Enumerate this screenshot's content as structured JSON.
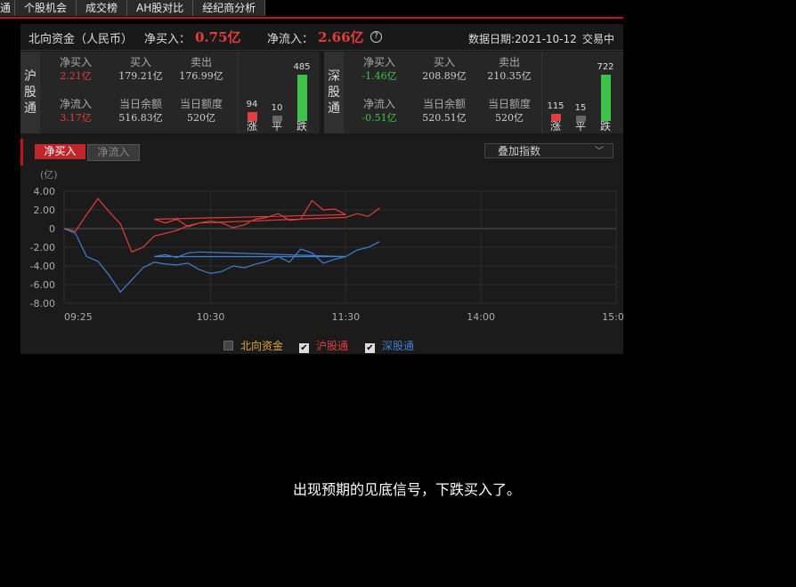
{
  "tabs": [
    "通",
    "个股机会",
    "成交榜",
    "AH股对比",
    "经纪商分析"
  ],
  "header": {
    "title": "北向资金（人民币）",
    "net_buy_label": "净买入：",
    "net_buy_value": "0.75亿",
    "net_inflow_label": "净流入：",
    "net_inflow_value": "2.66亿",
    "help_icon": "?",
    "date": "数据日期:2021-10-12",
    "status": "交易中"
  },
  "sh": {
    "label": "沪股通",
    "net_buy_label": "净买入",
    "net_buy": "2.21亿",
    "buy_label": "买入",
    "buy": "179.21亿",
    "sell_label": "卖出",
    "sell": "176.99亿",
    "net_inflow_label": "净流入",
    "net_inflow": "3.17亿",
    "balance_label": "当日余额",
    "balance": "516.83亿",
    "quota_label": "当日额度",
    "quota": "520亿",
    "up": 94,
    "flat": 10,
    "down": 485,
    "up_label": "涨",
    "flat_label": "平",
    "down_label": "跌"
  },
  "sz": {
    "label": "深股通",
    "net_buy_label": "净买入",
    "net_buy": "-1.46亿",
    "buy_label": "买入",
    "buy": "208.89亿",
    "sell_label": "卖出",
    "sell": "210.35亿",
    "net_inflow_label": "净流入",
    "net_inflow": "-0.51亿",
    "balance_label": "当日余额",
    "balance": "520.51亿",
    "quota_label": "当日额度",
    "quota": "520亿",
    "up": 115,
    "flat": 15,
    "down": 722,
    "up_label": "涨",
    "flat_label": "平",
    "down_label": "跌"
  },
  "chart_controls": {
    "btn_net_buy": "净买入",
    "btn_net_inflow": "净流入",
    "overlay_label": "叠加指数",
    "overlay_chevron": "﹀"
  },
  "legend": {
    "north": "北向资金",
    "sh": "沪股通",
    "sz": "深股通",
    "check_mark": "✔"
  },
  "colors": {
    "red": "#e63c3c",
    "green": "#3ec24a",
    "blue": "#3f7fd1",
    "gold": "#d9a640"
  },
  "caption": "出现预期的见底信号，下跌买入了。",
  "chart_data": {
    "type": "line",
    "ylabel": "(亿)",
    "ylim": [
      -8,
      4
    ],
    "yticks": [
      "4.00",
      "2.00",
      "0",
      "-2.00",
      "-4.00",
      "-6.00",
      "-8.00"
    ],
    "xticks": [
      "09:25",
      "10:30",
      "11:30",
      "14:00",
      "15:00"
    ],
    "x": [
      "09:25",
      "09:30",
      "09:35",
      "09:40",
      "09:45",
      "09:50",
      "09:55",
      "10:00",
      "10:05",
      "10:10",
      "10:15",
      "10:20",
      "10:25",
      "10:30",
      "10:35",
      "10:40",
      "10:45",
      "10:50",
      "10:55",
      "11:00",
      "11:05",
      "11:10",
      "11:15",
      "11:20",
      "11:25",
      "11:30",
      "11:35",
      "11:40",
      "11:45",
      "11:50",
      "11:55",
      "13:00",
      "13:05",
      "13:10",
      "13:15"
    ],
    "series": [
      {
        "name": "沪股通",
        "values": [
          0,
          -0.3,
          1.5,
          3.2,
          1.8,
          0.5,
          -2.5,
          -2.0,
          -0.8,
          -0.5,
          -0.2,
          0.3,
          0.6,
          0.8,
          0.6,
          0.1,
          0.4,
          1.0,
          1.2,
          1.6,
          0.9,
          1.0,
          3.0,
          2.0,
          2.1,
          1.5,
          1.0,
          0.6,
          1.0,
          0.2,
          0.6,
          1.2,
          1.6,
          1.3,
          2.2
        ]
      },
      {
        "name": "深股通",
        "values": [
          0,
          -0.5,
          -3.0,
          -3.5,
          -5.0,
          -6.8,
          -5.5,
          -4.2,
          -3.6,
          -3.8,
          -3.9,
          -3.7,
          -4.4,
          -4.8,
          -4.6,
          -4.0,
          -4.2,
          -3.8,
          -3.5,
          -3.0,
          -3.6,
          -2.2,
          -2.6,
          -3.7,
          -3.3,
          -3.0,
          -3.0,
          -2.8,
          -3.1,
          -2.6,
          -2.5,
          -3.0,
          -2.3,
          -2.0,
          -1.4
        ]
      }
    ]
  }
}
